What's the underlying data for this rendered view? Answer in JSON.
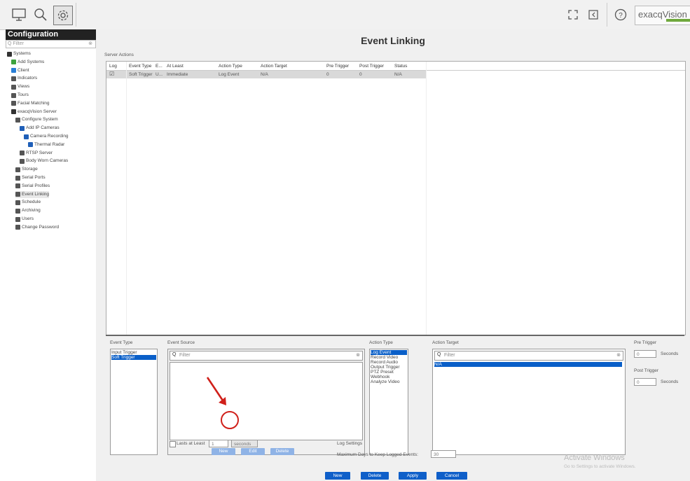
{
  "topbar": {
    "icons": [
      "monitor-icon",
      "search-icon",
      "gear-icon",
      "expand-icon",
      "exit-icon",
      "help-icon"
    ],
    "logo_text": "exacqVision"
  },
  "sidebar": {
    "title": "Configuration",
    "filter_placeholder": "Filter",
    "items": [
      {
        "label": "Systems",
        "indent": 0,
        "icon": "server-icon"
      },
      {
        "label": "Add Systems",
        "indent": 1,
        "icon": "add-icon"
      },
      {
        "label": "Client",
        "indent": 1,
        "icon": "client-icon"
      },
      {
        "label": "Indicators",
        "indent": 1,
        "icon": "indicator-icon"
      },
      {
        "label": "Views",
        "indent": 1,
        "icon": "views-icon"
      },
      {
        "label": "Tours",
        "indent": 1,
        "icon": "tours-icon"
      },
      {
        "label": "Facial Matching",
        "indent": 1,
        "icon": "face-icon"
      },
      {
        "label": "exacqVision Server",
        "indent": 1,
        "icon": "server-icon"
      },
      {
        "label": "Configure System",
        "indent": 2,
        "icon": "config-icon"
      },
      {
        "label": "Add IP Cameras",
        "indent": 3,
        "icon": "camera-icon"
      },
      {
        "label": "Camera Recording",
        "indent": 4,
        "icon": "camera-icon"
      },
      {
        "label": "Thermal Radar",
        "indent": 5,
        "icon": "camera-icon"
      },
      {
        "label": "RTSP Server",
        "indent": 3,
        "icon": "rtsp-icon"
      },
      {
        "label": "Body Worn Cameras",
        "indent": 3,
        "icon": "body-cam-icon"
      },
      {
        "label": "Storage",
        "indent": 2,
        "icon": "storage-icon"
      },
      {
        "label": "Serial Ports",
        "indent": 2,
        "icon": "serial-icon"
      },
      {
        "label": "Serial Profiles",
        "indent": 2,
        "icon": "profile-icon"
      },
      {
        "label": "Event Linking",
        "indent": 2,
        "icon": "link-icon"
      },
      {
        "label": "Schedule",
        "indent": 2,
        "icon": "schedule-icon"
      },
      {
        "label": "Archiving",
        "indent": 2,
        "icon": "archive-icon"
      },
      {
        "label": "Users",
        "indent": 2,
        "icon": "users-icon"
      },
      {
        "label": "Change Password",
        "indent": 2,
        "icon": "password-icon"
      }
    ]
  },
  "main": {
    "title": "Event Linking",
    "server_actions_label": "Server Actions",
    "table": {
      "columns": [
        "Log",
        "Event Type",
        "E...",
        "At Least",
        "Action Type",
        "Action Target",
        "Pre Trigger",
        "Post Trigger",
        "Status"
      ],
      "rows": [
        {
          "log": "☑",
          "event_type": "Soft Trigger",
          "e": "U...",
          "at_least": "Immediate",
          "action_type": "Log Event",
          "action_target": "N/A",
          "pre": "0",
          "post": "0",
          "status": "N/A"
        }
      ]
    },
    "event_type": {
      "label": "Event Type",
      "items": [
        {
          "label": "Input Trigger",
          "selected": false
        },
        {
          "label": "Soft Trigger",
          "selected": true
        }
      ]
    },
    "event_source": {
      "label": "Event Source",
      "filter_placeholder": "Filter",
      "lasts_label": "Lasts at Least",
      "lasts_value": "1",
      "unit": "seconds",
      "buttons": {
        "new": "New",
        "edit": "Edit",
        "delete": "Delete"
      }
    },
    "action_type": {
      "label": "Action Type",
      "items": [
        {
          "label": "Log Event",
          "selected": true
        },
        {
          "label": "Record Video",
          "selected": false
        },
        {
          "label": "Record Audio",
          "selected": false
        },
        {
          "label": "Output Trigger",
          "selected": false
        },
        {
          "label": "PTZ Preset",
          "selected": false
        },
        {
          "label": "Webhook",
          "selected": false
        },
        {
          "label": "Analyze Video",
          "selected": false
        }
      ]
    },
    "action_target": {
      "label": "Action Target",
      "filter_placeholder": "Filter",
      "items": [
        {
          "label": "N/A",
          "selected": true
        }
      ]
    },
    "pre_trigger": {
      "label": "Pre Trigger",
      "value": "0",
      "unit": "Seconds"
    },
    "post_trigger": {
      "label": "Post Trigger",
      "value": "0",
      "unit": "Seconds"
    },
    "log_settings": {
      "label": "Log Settings",
      "max_days_label": "Maximum Days to Keep Logged Events:",
      "max_days_value": "30"
    },
    "bottom_buttons": {
      "new": "New",
      "delete": "Delete",
      "apply": "Apply",
      "cancel": "Cancel"
    },
    "watermark": {
      "line1": "Activate Windows",
      "line2": "Go to Settings to activate Windows."
    }
  },
  "colors": {
    "accent": "#0f5fc9",
    "selection": "#0a5fc8",
    "annotation": "#d0201a"
  }
}
